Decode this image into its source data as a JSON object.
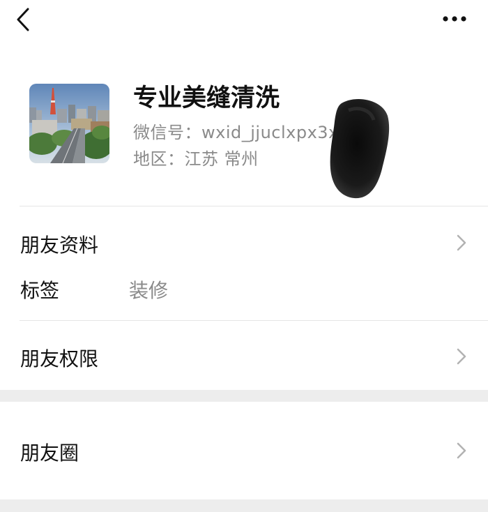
{
  "topbar": {
    "back_icon": "chevron-left-icon",
    "more_icon": "more-dots-icon"
  },
  "profile": {
    "name": "专业美缝清洗",
    "wechat_id_line": "微信号：wxid_jjuclxpx3x",
    "region_line": "地区：江苏 常州"
  },
  "rows": {
    "friend_profile": "朋友资料",
    "tag_label": "标签",
    "tag_value": "装修",
    "friend_permissions": "朋友权限",
    "moments": "朋友圈"
  },
  "colors": {
    "background": "#ffffff",
    "section_gap": "#ededed",
    "divider": "#e5e5e5",
    "primary_text": "#111111",
    "secondary_text": "#8a8a8a",
    "chevron": "#b2b2b2"
  }
}
